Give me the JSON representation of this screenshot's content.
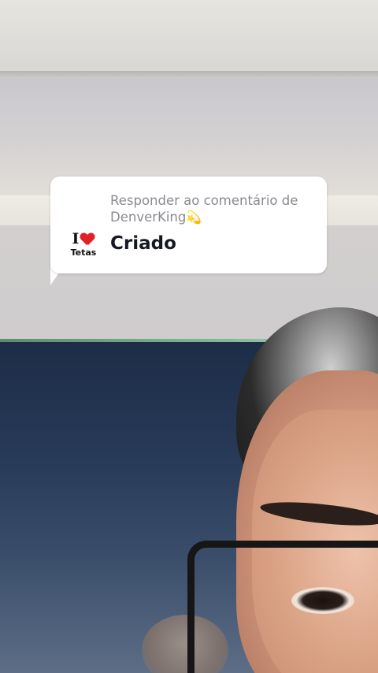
{
  "reply_card": {
    "header_prefix": "Responder ao comentário de",
    "username": "DenverKing",
    "username_emoji": "💫",
    "comment_text": "Criado",
    "avatar": {
      "top_letter": "I",
      "heart_icon": "heart-icon",
      "word": "Tetas"
    }
  },
  "colors": {
    "bubble_bg": "#ffffff",
    "header_text": "#8a8b91",
    "comment_text": "#161823",
    "heart": "#e0202a"
  }
}
